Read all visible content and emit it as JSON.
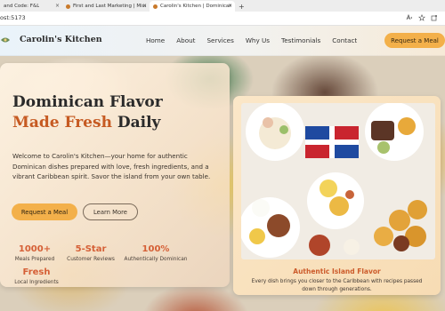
{
  "browser": {
    "tabs": [
      {
        "label": "and Code: F&L"
      },
      {
        "label": "First and Last Marketing | Missio"
      },
      {
        "label": "Carolin's Kitchen | Dominican Ca"
      }
    ],
    "new_tab_glyph": "+",
    "close_glyph": "×",
    "url": "ost:5173",
    "address_icons": [
      "read-aloud-icon",
      "star-icon",
      "extensions-icon"
    ]
  },
  "nav": {
    "brand": "Carolin's Kitchen",
    "links": [
      "Home",
      "About",
      "Services",
      "Why Us",
      "Testimonials",
      "Contact"
    ],
    "cta": "Request a Meal"
  },
  "hero": {
    "title_line1": "Dominican Flavor",
    "title_line2_accent": "Made Fresh",
    "title_line2_rest": " Daily",
    "description": "Welcome to Carolin's Kitchen—your home for authentic Dominican dishes prepared with love, fresh ingredients, and a vibrant Caribbean spirit. Savor the island from your own table.",
    "primary_button": "Request a Meal",
    "secondary_button": "Learn More",
    "stats": [
      {
        "value": "1000+",
        "label": "Meals Prepared"
      },
      {
        "value": "5-Star",
        "label": "Customer Reviews"
      },
      {
        "value": "100%",
        "label": "Authentically Dominican"
      },
      {
        "value": "Fresh",
        "label": "Local Ingredients"
      }
    ]
  },
  "feature_card": {
    "title": "Authentic Island Flavor",
    "description": "Every dish brings you closer to the Caribbean with recipes passed down through generations."
  },
  "colors": {
    "accent": "#c65a22",
    "stat_accent": "#d55f36",
    "button": "#f3b04a"
  }
}
